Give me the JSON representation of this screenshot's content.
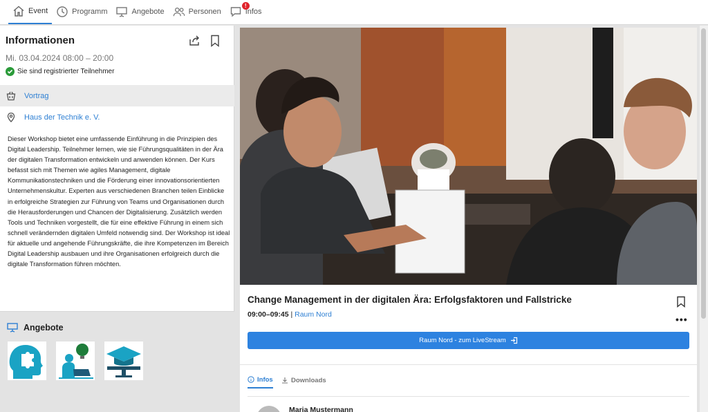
{
  "nav": {
    "items": [
      {
        "label": "Event",
        "icon": "home-icon"
      },
      {
        "label": "Programm",
        "icon": "clock-icon"
      },
      {
        "label": "Angebote",
        "icon": "presentation-icon"
      },
      {
        "label": "Personen",
        "icon": "people-icon"
      },
      {
        "label": "Infos",
        "icon": "chat-icon",
        "badge": "!"
      }
    ],
    "active": "Event"
  },
  "info": {
    "title": "Informationen",
    "date": "Mi. 03.04.2024 08:00 – 20:00",
    "registered": "Sie sind registrierter Teilnehmer",
    "type": "Vortrag",
    "location": "Haus der Technik e. V.",
    "description": "Dieser Workshop bietet eine umfassende Einführung in die Prinzipien des Digital Leadership. Teilnehmer lernen, wie sie Führungsqualitäten in der Ära der digitalen Transformation entwickeln und anwenden können. Der Kurs befasst sich mit Themen wie agiles Management, digitale Kommunikationstechniken und die Förderung einer innovationsorientierten Unternehmenskultur. Experten aus verschiedenen Branchen teilen Einblicke in erfolgreiche Strategien zur Führung von Teams und Organisationen durch die Herausforderungen und Chancen der Digitalisierung. Zusätzlich werden Tools und Techniken vorgestellt, die für eine effektive Führung in einem sich schnell verändernden digitalen Umfeld notwendig sind. Der Workshop ist ideal für aktuelle und angehende Führungskräfte, die ihre Kompetenzen im Bereich Digital Leadership ausbauen und ihre Organisationen erfolgreich durch die digitale Transformation führen möchten."
  },
  "offers": {
    "title": "Angebote",
    "items": [
      "head-puzzle-icon",
      "person-laptop-idea-icon",
      "graduation-cap-screen-icon"
    ]
  },
  "session": {
    "title": "Change Management in der digitalen Ära: Erfolgsfaktoren und Fallstricke",
    "time": "09:00–09:45",
    "separator": " | ",
    "room": "Raum Nord",
    "more": "•••",
    "stream_button": "Raum Nord - zum LiveStream",
    "tabs": [
      "Infos",
      "Downloads"
    ],
    "active_tab": "Infos",
    "speaker": "Maria Mustermann"
  },
  "colors": {
    "accent": "#2d7fd3",
    "button": "#2d82e0",
    "badge": "#e0242c",
    "success": "#2b9b3a"
  }
}
